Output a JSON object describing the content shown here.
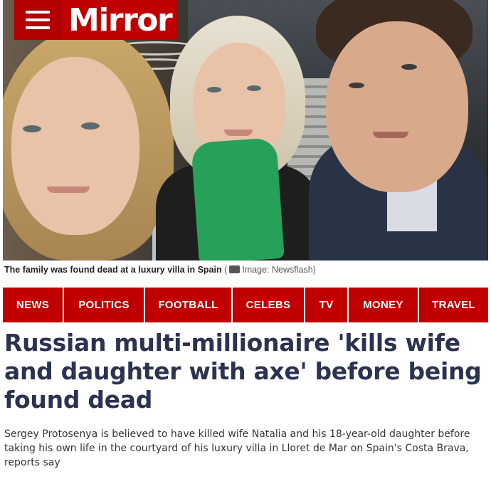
{
  "logo": {
    "text": "Mirror",
    "color": "#c00000"
  },
  "menu": {
    "icon": "hamburger-menu-icon"
  },
  "caption": {
    "text": "The family was found dead at a luxury villa in Spain",
    "icon": "camera-icon",
    "credit": "Image: Newsflash"
  },
  "nav": {
    "items": [
      {
        "label": "NEWS"
      },
      {
        "label": "POLITICS"
      },
      {
        "label": "FOOTBALL"
      },
      {
        "label": "CELEBS"
      },
      {
        "label": "TV"
      },
      {
        "label": "MONEY"
      },
      {
        "label": "TRAVEL"
      }
    ],
    "background": "#c00000"
  },
  "article": {
    "headline": "Russian multi-millionaire 'kills wife and daughter with axe' before being found dead",
    "standfirst": "Sergey Protosenya is believed to have killed wife Natalia and his 18-year-old daughter before taking his own life in the courtyard of his luxury villa in Lloret de Mar on Spain's Costa Brava, reports say"
  }
}
